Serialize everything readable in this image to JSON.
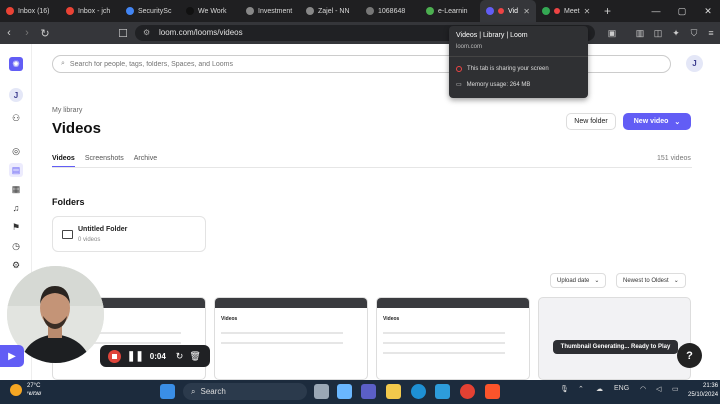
{
  "tabs": [
    {
      "label": "Inbox (16)",
      "color": "#ea4335"
    },
    {
      "label": "Inbox - jch",
      "color": "#ea4335"
    },
    {
      "label": "SecuritySc",
      "color": "#4285f4"
    },
    {
      "label": "We Work",
      "color": "#222222"
    },
    {
      "label": "Investment",
      "color": "#888888"
    },
    {
      "label": "Zajel - NN",
      "color": "#888888"
    },
    {
      "label": "1068648",
      "color": "#777777"
    },
    {
      "label": "e-Learnin",
      "color": "#4caf50"
    },
    {
      "label": "Vid",
      "color": "#625df5"
    },
    {
      "label": "Meet",
      "color": "#34a853"
    }
  ],
  "new_tab": "+",
  "window_controls": {
    "minimize": "—",
    "maximize": "▢",
    "close": "✕"
  },
  "address": {
    "url": "loom.com/looms/videos"
  },
  "popup": {
    "title": "Videos | Library | Loom",
    "domain": "loom.com",
    "sharing": "This tab is sharing your screen",
    "memory": "Memory usage: 264 MB"
  },
  "search": {
    "placeholder": "Search for people, tags, folders, Spaces, and Looms"
  },
  "user_initial": "J",
  "library": {
    "crumb": "My library",
    "title": "Videos",
    "new_folder": "New folder",
    "new_video": "New video"
  },
  "tabs2": {
    "videos": "Videos",
    "screenshots": "Screenshots",
    "archive": "Archive"
  },
  "video_count": "151 videos",
  "folders_section": "Folders",
  "folder": {
    "name": "Untitled Folder",
    "count": "0 videos"
  },
  "sort": {
    "by": "Upload date",
    "order": "Newest to Oldest"
  },
  "thumb_title": "Videos",
  "generating": "Thumbnail Generating... Ready to Play",
  "help": "?",
  "recorder": {
    "time": "0:04"
  },
  "taskbar": {
    "temp": "27°C",
    "weather": "שמשי",
    "search": "Search",
    "lang": "ENG",
    "time": "21:36",
    "date": "25/10/2024"
  }
}
